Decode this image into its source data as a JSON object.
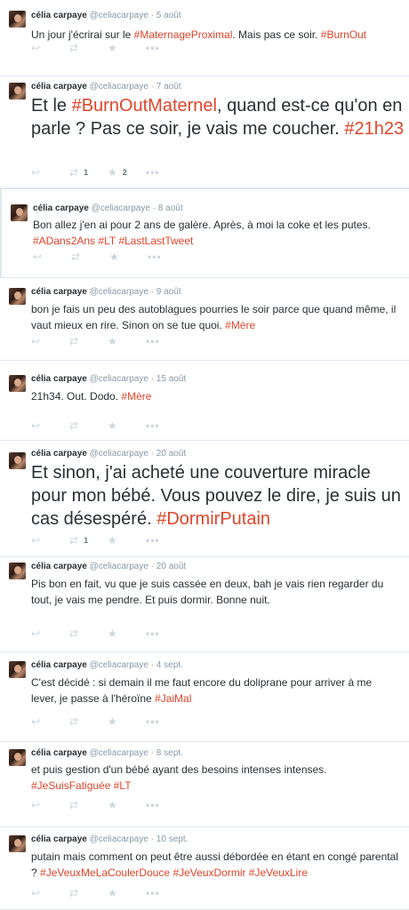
{
  "tweets": [
    {
      "name": "célia carpaye",
      "handle": "@celiacarpaye",
      "date": "5 août",
      "segments": [
        {
          "t": "Un jour j'écrirai sur le "
        },
        {
          "t": "#MaternageProximal",
          "tag": true
        },
        {
          "t": ". Mais pas ce soir. "
        },
        {
          "t": "#BurnOut",
          "tag": true
        }
      ],
      "retweets": "",
      "favorites": ""
    },
    {
      "name": "célia carpaye",
      "handle": "@celiacarpaye",
      "date": "7 août",
      "segments": [
        {
          "t": "Et le "
        },
        {
          "t": "#BurnOutMaternel",
          "tag": true
        },
        {
          "t": ", quand est-ce qu'on en parle ? Pas ce soir, je vais me coucher. "
        },
        {
          "t": "#21h23",
          "tag": true
        }
      ],
      "retweets": "1",
      "favorites": "2"
    },
    {
      "name": "célia carpaye",
      "handle": "@celiacarpaye",
      "date": "8 août",
      "segments": [
        {
          "t": "Bon allez j'en ai pour 2 ans de galère. Après, à moi la coke et les putes. "
        },
        {
          "t": "#ADans2Ans",
          "tag": true
        },
        {
          "t": " "
        },
        {
          "t": "#LT",
          "tag": true
        },
        {
          "t": " "
        },
        {
          "t": "#LastLastTweet",
          "tag": true
        }
      ],
      "retweets": "",
      "favorites": ""
    },
    {
      "name": "célia carpaye",
      "handle": "@celiacarpaye",
      "date": "9 août",
      "segments": [
        {
          "t": "bon je fais un peu des autoblagues pourries le soir parce que quand même, il vaut mieux en rire. Sinon on se tue quoi. "
        },
        {
          "t": "#Mère",
          "tag": true
        }
      ],
      "retweets": "",
      "favorites": ""
    },
    {
      "name": "célia carpaye",
      "handle": "@celiacarpaye",
      "date": "15 août",
      "segments": [
        {
          "t": "21h34. Out. Dodo. "
        },
        {
          "t": "#Mère",
          "tag": true
        }
      ],
      "retweets": "",
      "favorites": ""
    },
    {
      "name": "célia carpaye",
      "handle": "@celiacarpaye",
      "date": "20 août",
      "segments": [
        {
          "t": "Et sinon, j'ai acheté une couverture miracle pour mon bébé. Vous pouvez le dire, je suis un cas désespéré. "
        },
        {
          "t": "#DormirPutain",
          "tag": true
        }
      ],
      "retweets": "1",
      "favorites": ""
    },
    {
      "name": "célia carpaye",
      "handle": "@celiacarpaye",
      "date": "20 août",
      "segments": [
        {
          "t": "Pis bon en fait, vu que je suis cassée en deux, bah je vais rien regarder du tout, je vais me pendre. Et puis dormir. Bonne nuit."
        }
      ],
      "retweets": "",
      "favorites": ""
    },
    {
      "name": "célia carpaye",
      "handle": "@celiacarpaye",
      "date": "4 sept.",
      "segments": [
        {
          "t": "C'est décidé : si demain il me faut encore du doliprane pour arriver à me lever, je passe à l'héroïne "
        },
        {
          "t": "#JaiMal",
          "tag": true
        }
      ],
      "retweets": "",
      "favorites": ""
    },
    {
      "name": "célia carpaye",
      "handle": "@celiacarpaye",
      "date": "8 sept.",
      "segments": [
        {
          "t": "et puis gestion d'un bébé ayant des besoins intenses intenses. "
        },
        {
          "t": "#JeSuisFatiguée",
          "tag": true
        },
        {
          "t": " "
        },
        {
          "t": "#LT",
          "tag": true
        }
      ],
      "retweets": "",
      "favorites": ""
    },
    {
      "name": "célia carpaye",
      "handle": "@celiacarpaye",
      "date": "10 sept.",
      "segments": [
        {
          "t": "putain mais comment on peut être aussi débordée en étant en congé parental ? "
        },
        {
          "t": "#JeVeuxMeLaCoulerDouce",
          "tag": true
        },
        {
          "t": " "
        },
        {
          "t": "#JeVeuxDormir",
          "tag": true
        },
        {
          "t": " "
        },
        {
          "t": "#JeVeuxLire",
          "tag": true
        }
      ],
      "retweets": "",
      "favorites": ""
    }
  ],
  "icons": {
    "reply": "reply-icon",
    "retweet": "retweet-icon",
    "favorite": "star-icon",
    "more": "more-icon"
  },
  "colors": {
    "hashtag": "#e0452b",
    "meta": "#8899a6",
    "icon": "#ccd6dd",
    "text": "#292f33"
  }
}
